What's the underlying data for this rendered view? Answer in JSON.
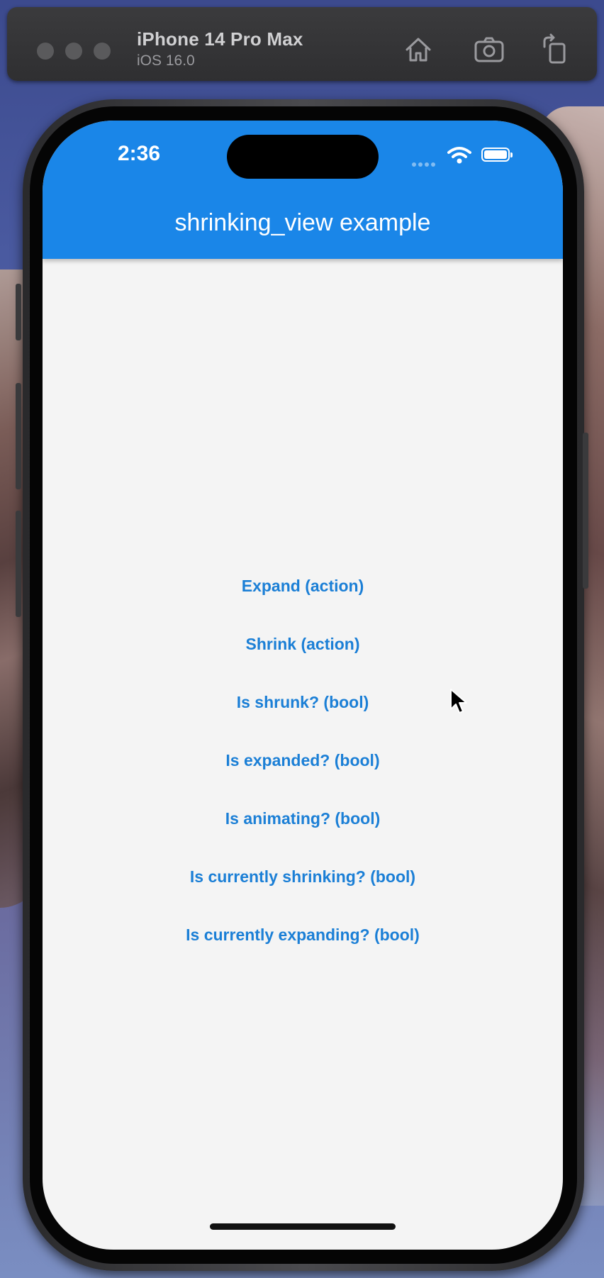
{
  "simulator": {
    "device_name": "iPhone 14 Pro Max",
    "os_version": "iOS 16.0",
    "icons": [
      "home-icon",
      "screenshot-icon",
      "rotate-icon"
    ]
  },
  "status_bar": {
    "time": "2:36",
    "icons": [
      "cellular-icon",
      "wifi-icon",
      "battery-icon"
    ]
  },
  "app_bar": {
    "title": "shrinking_view example",
    "color": "#1a86e8"
  },
  "actions": [
    {
      "label": "Expand (action)"
    },
    {
      "label": "Shrink (action)"
    },
    {
      "label": "Is shrunk? (bool)"
    },
    {
      "label": "Is expanded? (bool)"
    },
    {
      "label": "Is animating? (bool)"
    },
    {
      "label": "Is currently shrinking? (bool)"
    },
    {
      "label": "Is currently expanding? (bool)"
    }
  ],
  "colors": {
    "action_text": "#1b7fd6",
    "screen_background": "#f4f4f4"
  }
}
